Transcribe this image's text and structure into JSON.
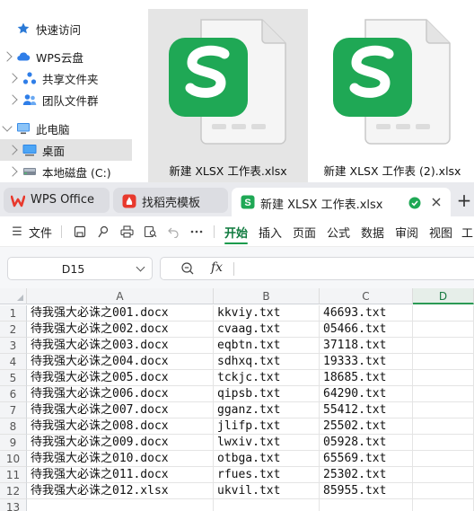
{
  "explorer": {
    "nav": [
      {
        "label": "快速访问",
        "icon": "star-icon",
        "expander": false,
        "selected": false
      },
      {
        "label": "WPS云盘",
        "icon": "cloud-icon",
        "expander": true,
        "selected": false
      },
      {
        "label": "共享文件夹",
        "icon": "share-icon",
        "expander": true,
        "selected": false
      },
      {
        "label": "团队文件群",
        "icon": "team-icon",
        "expander": true,
        "selected": false
      },
      {
        "label": "此电脑",
        "icon": "computer-icon",
        "expander": true,
        "selected": false
      },
      {
        "label": "桌面",
        "icon": "desktop-icon",
        "expander": true,
        "selected": true
      },
      {
        "label": "本地磁盘 (C:)",
        "icon": "drive-icon",
        "expander": true,
        "selected": false
      }
    ],
    "files": [
      {
        "name": "新建 XLSX 工作表.xlsx",
        "icon": "wps-spreadsheet-file-icon",
        "selected": true
      },
      {
        "name": "新建 XLSX 工作表 (2).xlsx",
        "icon": "wps-spreadsheet-file-icon",
        "selected": false
      }
    ]
  },
  "wps": {
    "tabs": [
      {
        "label": "WPS Office",
        "icon": "wps-logo-icon",
        "active": false
      },
      {
        "label": "找稻壳模板",
        "icon": "docer-template-icon",
        "active": false
      },
      {
        "label": "新建 XLSX 工作表.xlsx",
        "icon": "spreadsheet-icon",
        "active": true
      }
    ],
    "new_tab_label": "+",
    "ribbon": {
      "menu_icon": "☰",
      "file_label": "文件",
      "tabs": [
        "开始",
        "插入",
        "页面",
        "公式",
        "数据",
        "审阅",
        "视图",
        "工"
      ],
      "active_tab": "开始"
    },
    "formula_bar": {
      "cell_ref": "D15",
      "fx_label": "fx",
      "content": ""
    },
    "sheet": {
      "columns": [
        "A",
        "B",
        "C",
        "D"
      ],
      "selected_column": "D",
      "rows": [
        {
          "n": "1",
          "a": "待我强大必诛之001.docx",
          "b": "kkviy.txt",
          "c": "46693.txt"
        },
        {
          "n": "2",
          "a": "待我强大必诛之002.docx",
          "b": "cvaag.txt",
          "c": "05466.txt"
        },
        {
          "n": "3",
          "a": "待我强大必诛之003.docx",
          "b": "eqbtn.txt",
          "c": "37118.txt"
        },
        {
          "n": "4",
          "a": "待我强大必诛之004.docx",
          "b": "sdhxq.txt",
          "c": "19333.txt"
        },
        {
          "n": "5",
          "a": "待我强大必诛之005.docx",
          "b": "tckjc.txt",
          "c": "18685.txt"
        },
        {
          "n": "6",
          "a": "待我强大必诛之006.docx",
          "b": "qipsb.txt",
          "c": "64290.txt"
        },
        {
          "n": "7",
          "a": "待我强大必诛之007.docx",
          "b": "gganz.txt",
          "c": "55412.txt"
        },
        {
          "n": "8",
          "a": "待我强大必诛之008.docx",
          "b": "jlifp.txt",
          "c": "25502.txt"
        },
        {
          "n": "9",
          "a": "待我强大必诛之009.docx",
          "b": "lwxiv.txt",
          "c": "05928.txt"
        },
        {
          "n": "10",
          "a": "待我强大必诛之010.docx",
          "b": "otbga.txt",
          "c": "65569.txt"
        },
        {
          "n": "11",
          "a": "待我强大必诛之011.docx",
          "b": "rfues.txt",
          "c": "25302.txt"
        },
        {
          "n": "12",
          "a": "待我强大必诛之012.xlsx",
          "b": "ukvil.txt",
          "c": "85955.txt"
        },
        {
          "n": "13",
          "a": "",
          "b": "",
          "c": ""
        }
      ]
    }
  },
  "colors": {
    "wps_green": "#1fa855",
    "active_tab_green": "#0f7a3e",
    "wps_red": "#e8392d"
  }
}
